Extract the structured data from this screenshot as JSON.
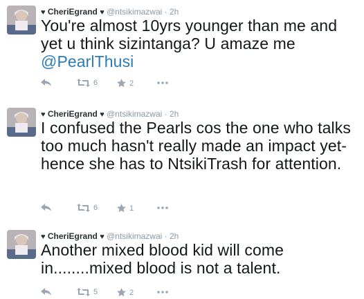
{
  "tweets": [
    {
      "name": "CheriEgrand",
      "heart_prefix": "♥",
      "heart_suffix": "♥",
      "handle": "@ntsikimazwai",
      "separator": "·",
      "time": "2h",
      "text": "You're almost 10yrs younger than me and yet u think sizintanga? U amaze me",
      "mention": "@PearlThusi",
      "retweets": "6",
      "favorites": "2"
    },
    {
      "name": "CheriEgrand",
      "heart_prefix": "♥",
      "heart_suffix": "♥",
      "handle": "@ntsikimazwai",
      "separator": "·",
      "time": "2h",
      "text": "I confused the Pearls cos the one who talks too much hasn't really made an impact yet- hence she has to NtsikiTrash for attention.",
      "retweets": "6",
      "favorites": "1"
    },
    {
      "name": "CheriEgrand",
      "heart_prefix": "♥",
      "heart_suffix": "♥",
      "handle": "@ntsikimazwai",
      "separator": "·",
      "time": "2h",
      "text": "Another mixed blood kid will come in........mixed blood is not a talent.",
      "retweets": "5",
      "favorites": "2"
    }
  ],
  "icons": {
    "reply": "reply-icon",
    "retweet": "retweet-icon",
    "favorite": "star-icon",
    "more": "more-icon"
  },
  "colors": {
    "link": "#2b7bb9",
    "muted": "#8899a6",
    "action": "#9aa7b2"
  }
}
